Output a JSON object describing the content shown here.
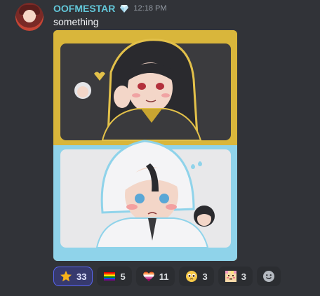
{
  "message": {
    "author": "OOFMESTAR",
    "timestamp": "12:18 PM",
    "text": "something",
    "author_color": "#62c6d8"
  },
  "attachment": {
    "kind": "image",
    "description_icon": "anime-fanart-image"
  },
  "reactions": [
    {
      "emoji": "star-emoji",
      "count": "33",
      "selected": true
    },
    {
      "emoji": "rainbow-flag-emoji",
      "count": "5",
      "selected": false
    },
    {
      "emoji": "lesbian-heart-emoji",
      "count": "11",
      "selected": false
    },
    {
      "emoji": "pleading-face-emoji",
      "count": "3",
      "selected": false
    },
    {
      "emoji": "pixel-blush-emoji",
      "count": "3",
      "selected": false
    }
  ],
  "add_reaction_icon": "smiley-add-icon",
  "colors": {
    "background": "#313338",
    "reaction_bg": "#2b2d31",
    "reaction_selected_bg": "#373a6e",
    "reaction_selected_border": "#5865f2",
    "image_frame_gold": "#d9b63b",
    "image_frame_cyan": "#8fd3ea"
  }
}
